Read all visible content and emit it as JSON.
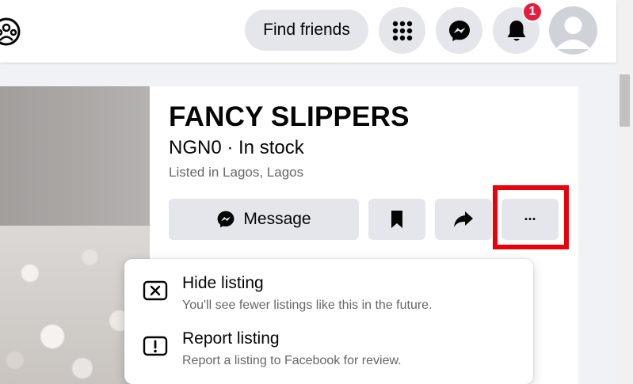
{
  "header": {
    "find_friends_label": "Find friends",
    "notification_count": "1",
    "icons": [
      "groups-icon",
      "menu-grid-icon",
      "messenger-icon",
      "bell-icon",
      "avatar"
    ]
  },
  "listing": {
    "title": "FANCY SLIPPERS",
    "price_status": "NGN0 · In stock",
    "location": "Listed in Lagos, Lagos",
    "message_label": "Message",
    "more_label": "···"
  },
  "menu": {
    "items": [
      {
        "title": "Hide listing",
        "subtitle": "You'll see fewer listings like this in the future.",
        "icon": "hide-icon"
      },
      {
        "title": "Report listing",
        "subtitle": "Report a listing to Facebook for review.",
        "icon": "report-icon"
      }
    ]
  },
  "colors": {
    "accent_red": "#e8000b",
    "badge_red": "#e41e3f",
    "button_gray": "#e4e6eb",
    "text_primary": "#050505",
    "text_secondary": "#65676b"
  }
}
